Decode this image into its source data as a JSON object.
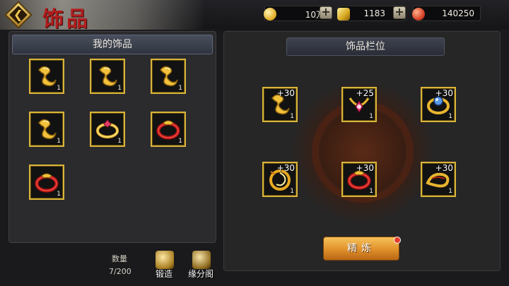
{
  "header": {
    "title": "饰品",
    "back_icon": "back-arrow-icon"
  },
  "currencies": [
    {
      "name": "silver",
      "amount": "10万",
      "color": "#e9c040"
    },
    {
      "name": "gold",
      "amount": "1183",
      "color": "#f2d05a"
    },
    {
      "name": "gem",
      "amount": "140250",
      "color": "#d8452a"
    }
  ],
  "left_panel": {
    "title": "我的饰品",
    "items": [
      {
        "kind": "charm",
        "count": "1"
      },
      {
        "kind": "charm",
        "count": "1"
      },
      {
        "kind": "charm",
        "count": "1"
      },
      {
        "kind": "charm",
        "count": "1"
      },
      {
        "kind": "ring-gold",
        "count": "1"
      },
      {
        "kind": "ring-red",
        "count": "1"
      },
      {
        "kind": "ring-red",
        "count": "1"
      }
    ],
    "quantity_label": "数量",
    "quantity_value": "7/200"
  },
  "bottom_buttons": {
    "forge": "锻造",
    "pavilion": "缘分阁"
  },
  "right_panel": {
    "title": "饰品栏位",
    "slots": [
      {
        "kind": "charm",
        "plus": "+30",
        "count": "1"
      },
      {
        "kind": "necklace",
        "plus": "+25",
        "count": "1"
      },
      {
        "kind": "ring-blue",
        "plus": "+30",
        "count": "1"
      },
      {
        "kind": "coil",
        "plus": "+30",
        "count": "1"
      },
      {
        "kind": "ring-red",
        "plus": "+30",
        "count": "1"
      },
      {
        "kind": "bracelet",
        "plus": "+30",
        "count": "1"
      }
    ],
    "refine_button": "精炼"
  }
}
